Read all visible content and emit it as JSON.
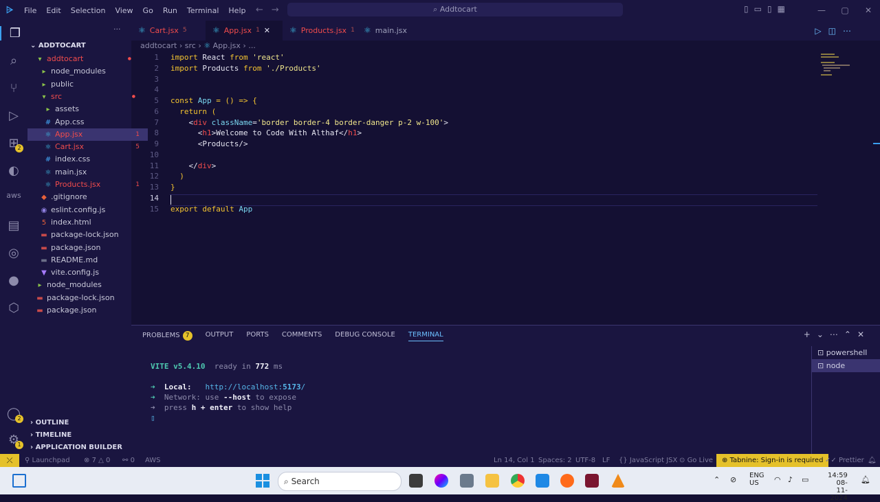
{
  "titlebar": {
    "menus": [
      "File",
      "Edit",
      "Selection",
      "View",
      "Go",
      "Run",
      "Terminal",
      "Help"
    ],
    "search": "Addtocart"
  },
  "explorer": {
    "root": "ADDTOCART",
    "rows": [
      {
        "label": "addtocart",
        "indent": 1,
        "type": "folder-open",
        "status": "error"
      },
      {
        "label": "node_modules",
        "indent": 2,
        "type": "folder",
        "status": ""
      },
      {
        "label": "public",
        "indent": 2,
        "type": "folder",
        "status": ""
      },
      {
        "label": "src",
        "indent": 2,
        "type": "folder-open",
        "status": "error"
      },
      {
        "label": "assets",
        "indent": 3,
        "type": "folder",
        "status": ""
      },
      {
        "label": "App.css",
        "indent": 3,
        "type": "css",
        "status": ""
      },
      {
        "label": "App.jsx",
        "indent": 3,
        "type": "react",
        "status": "error-selected",
        "mark": "1"
      },
      {
        "label": "Cart.jsx",
        "indent": 3,
        "type": "react",
        "status": "error",
        "mark": "5"
      },
      {
        "label": "index.css",
        "indent": 3,
        "type": "css",
        "status": ""
      },
      {
        "label": "main.jsx",
        "indent": 3,
        "type": "react",
        "status": ""
      },
      {
        "label": "Products.jsx",
        "indent": 3,
        "type": "react",
        "status": "error",
        "mark": "1"
      },
      {
        "label": ".gitignore",
        "indent": 2,
        "type": "git",
        "status": ""
      },
      {
        "label": "eslint.config.js",
        "indent": 2,
        "type": "eslint",
        "status": ""
      },
      {
        "label": "index.html",
        "indent": 2,
        "type": "html",
        "status": ""
      },
      {
        "label": "package-lock.json",
        "indent": 2,
        "type": "npm",
        "status": ""
      },
      {
        "label": "package.json",
        "indent": 2,
        "type": "npm",
        "status": ""
      },
      {
        "label": "README.md",
        "indent": 2,
        "type": "md",
        "status": ""
      },
      {
        "label": "vite.config.js",
        "indent": 2,
        "type": "vite",
        "status": ""
      },
      {
        "label": "node_modules",
        "indent": 1,
        "type": "folder",
        "status": ""
      },
      {
        "label": "package-lock.json",
        "indent": 1,
        "type": "npm",
        "status": ""
      },
      {
        "label": "package.json",
        "indent": 1,
        "type": "npm",
        "status": ""
      }
    ],
    "sections": [
      "OUTLINE",
      "TIMELINE",
      "APPLICATION BUILDER"
    ]
  },
  "activity_badges": {
    "extensions": "2",
    "accounts": "2",
    "settings": "1"
  },
  "tabs": [
    {
      "label": "Cart.jsx",
      "mark": "5",
      "error": true,
      "active": false
    },
    {
      "label": "App.jsx",
      "mark": "1",
      "error": true,
      "active": true
    },
    {
      "label": "Products.jsx",
      "mark": "1",
      "error": true,
      "active": false
    },
    {
      "label": "main.jsx",
      "mark": "",
      "error": false,
      "active": false
    }
  ],
  "breadcrumb": [
    "addtocart",
    "src",
    "App.jsx",
    "..."
  ],
  "code": [
    {
      "n": "1",
      "html": "<span class='kw'>import</span> React <span class='kw'>from</span> <span class='str'>'react'</span>"
    },
    {
      "n": "2",
      "html": "<span class='kw'>import</span> Products <span class='kw'>from</span> <span class='str'>'./Products'</span>"
    },
    {
      "n": "3",
      "html": ""
    },
    {
      "n": "4",
      "html": ""
    },
    {
      "n": "5",
      "html": "<span class='kw'>const</span> <span class='fn'>App</span> <span class='kw'>=</span> <span class='kw'>()</span> <span class='kw'>=&gt;</span> <span class='kw'>{</span>"
    },
    {
      "n": "6",
      "html": "  <span class='kw'>return</span> <span class='kw'>(</span>"
    },
    {
      "n": "7",
      "html": "    &lt;<span class='tag'>div</span> <span class='attr'>className</span>=<span class='str'>'border border-4 border-danger p-2 w-100'</span>&gt;"
    },
    {
      "n": "8",
      "html": "      &lt;<span class='tag'>h1</span>&gt;Welcome to Code With Althaf&lt;/<span class='tag'>h1</span>&gt;"
    },
    {
      "n": "9",
      "html": "      &lt;Products/&gt;"
    },
    {
      "n": "10",
      "html": ""
    },
    {
      "n": "11",
      "html": "    &lt;/<span class='tag'>div</span>&gt;"
    },
    {
      "n": "12",
      "html": "  <span class='kw'>)</span>"
    },
    {
      "n": "13",
      "html": "<span class='kw'>}</span>"
    },
    {
      "n": "14",
      "html": ""
    },
    {
      "n": "15",
      "html": "<span class='kw'>export</span> <span class='kw'>default</span> <span class='fn'>App</span>"
    }
  ],
  "panel": {
    "tabs": [
      "PROBLEMS",
      "OUTPUT",
      "PORTS",
      "COMMENTS",
      "DEBUG CONSOLE",
      "TERMINAL"
    ],
    "problems_count": "7",
    "active_tab": "TERMINAL",
    "terminal_lines": {
      "vite": "VITE v5.4.10",
      "ready": "ready in",
      "ready_ms": "772",
      "ready_unit": "ms",
      "local_label": "Local:",
      "local_url": "http://localhost:",
      "local_port": "5173",
      "local_slash": "/",
      "network": "Network: use",
      "network_flag": "--host",
      "network_tail": "to expose",
      "press": "press",
      "press_key": "h + enter",
      "press_tail": "to show help"
    },
    "terminals": [
      "powershell",
      "node"
    ]
  },
  "statusbar": {
    "launchpad": "Launchpad",
    "errors": "7",
    "warnings": "0",
    "ports": "0",
    "aws": "AWS",
    "position": "Ln 14, Col 1",
    "spaces": "Spaces: 2",
    "encoding": "UTF-8",
    "eol": "LF",
    "language": "JavaScript JSX",
    "golive": "Go Live",
    "tabnine": "Tabnine: Sign-in is required",
    "prettier": "Prettier"
  },
  "taskbar": {
    "search": "Search",
    "lang": "ENG",
    "region": "US",
    "time": "14:59",
    "date": "08-11-2024"
  },
  "colors": {
    "accent": "#3ba0f0",
    "error": "#f14c4c",
    "warning_badge": "#e5c12a",
    "keyword": "#f4c430",
    "background": "#141033"
  }
}
